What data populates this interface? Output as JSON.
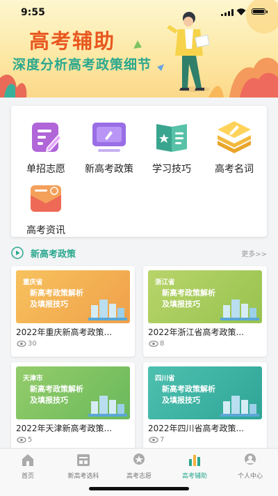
{
  "status": {
    "time": "9:55"
  },
  "banner": {
    "title": "高考辅助",
    "subtitle": "深度分析高考政策细节"
  },
  "menu": {
    "items": [
      {
        "label": "单招志愿",
        "icon": "single-admission-icon"
      },
      {
        "label": "新高考政策",
        "icon": "policy-screen-icon"
      },
      {
        "label": "学习技巧",
        "icon": "study-book-icon"
      },
      {
        "label": "高考名词",
        "icon": "term-stack-icon"
      },
      {
        "label": "高考资讯",
        "icon": "news-envelope-icon"
      }
    ]
  },
  "section": {
    "title": "新高考政策",
    "more": "更多>>"
  },
  "cards": [
    {
      "province": "重庆省",
      "line1": "新高考政策解析",
      "line2": "及填报技巧",
      "title": "2022年重庆新高考政策...",
      "views": "30",
      "color": "#f2a94a"
    },
    {
      "province": "浙江省",
      "line1": "新高考政策解析",
      "line2": "及填报技巧",
      "title": "2022年浙江省高考政策...",
      "views": "8",
      "color": "#a8cc58"
    },
    {
      "province": "天津市",
      "line1": "新高考政策解析",
      "line2": "及填报技巧",
      "title": "2022年天津新高考政策...",
      "views": "5",
      "color": "#7ec263"
    },
    {
      "province": "四川省",
      "line1": "新高考政策解析",
      "line2": "及填报技巧",
      "title": "2022年四川省高考政策...",
      "views": "7",
      "color": "#3db3a4"
    }
  ],
  "tabbar": {
    "tabs": [
      {
        "label": "首页",
        "icon": "home-icon"
      },
      {
        "label": "新高考选科",
        "icon": "subject-select-icon"
      },
      {
        "label": "高考志愿",
        "icon": "volunteer-icon"
      },
      {
        "label": "高考辅助",
        "icon": "assist-chart-icon",
        "active": true
      },
      {
        "label": "个人中心",
        "icon": "profile-icon"
      }
    ]
  },
  "colors": {
    "accent": "#2aa88e",
    "banner_title": "#e8571f"
  }
}
